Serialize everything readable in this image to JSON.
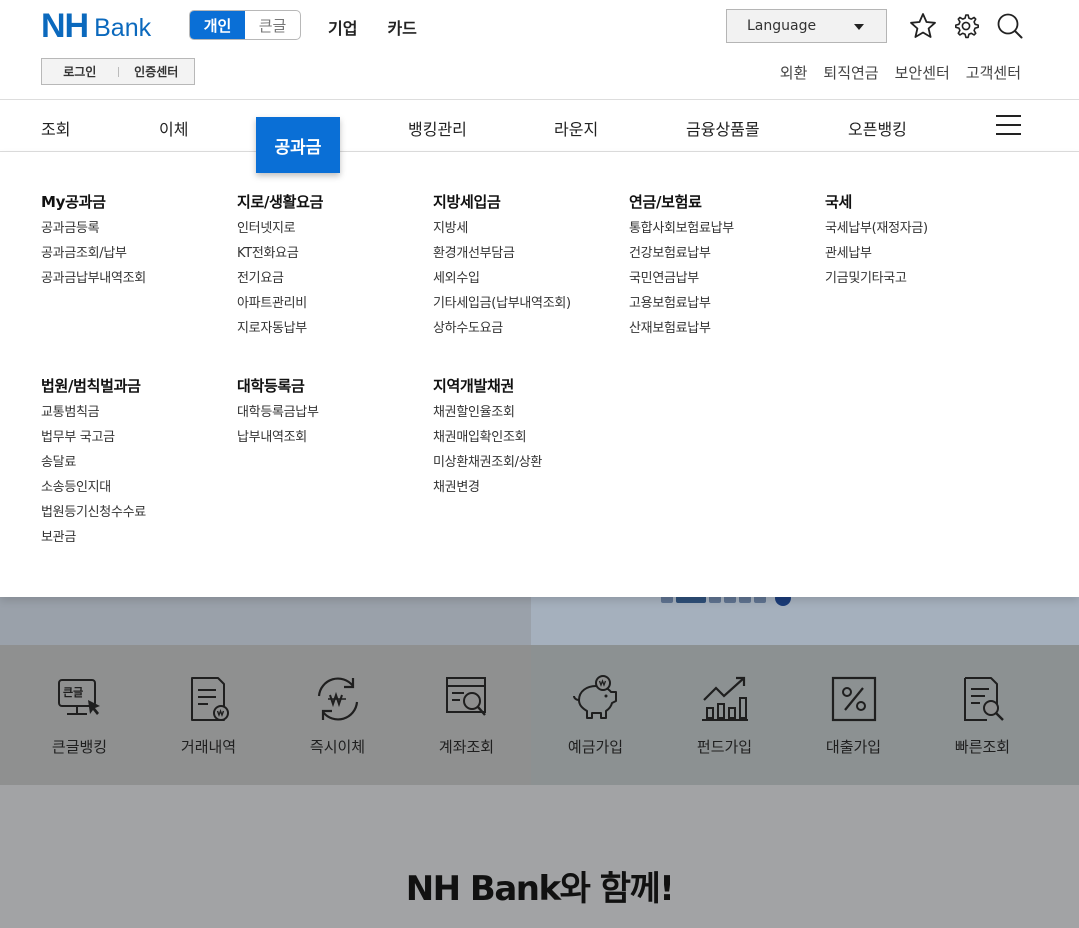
{
  "header": {
    "logo_nh": "NH",
    "logo_bank": "Bank",
    "segment": [
      "개인",
      "큰글"
    ],
    "top_nav": [
      "기업",
      "카드"
    ],
    "language": "Language",
    "login": "로그인",
    "cert": "인증센터",
    "util_links": [
      "외환",
      "퇴직연금",
      "보안센터",
      "고객센터"
    ]
  },
  "gnb": {
    "items": [
      "조회",
      "이체",
      "공과금",
      "뱅킹관리",
      "라운지",
      "금융상품몰",
      "오픈뱅킹"
    ],
    "active": "공과금"
  },
  "mega_menu": [
    {
      "title": "My공과금",
      "items": [
        "공과금등록",
        "공과금조회/납부",
        "공과금납부내역조회"
      ]
    },
    {
      "title": "지로/생활요금",
      "items": [
        "인터넷지로",
        "KT전화요금",
        "전기요금",
        "아파트관리비",
        "지로자동납부"
      ]
    },
    {
      "title": "지방세입금",
      "items": [
        "지방세",
        "환경개선부담금",
        "세외수입",
        "기타세입금(납부내역조회)",
        "상하수도요금"
      ]
    },
    {
      "title": "연금/보험료",
      "items": [
        "통합사회보험료납부",
        "건강보험료납부",
        "국민연금납부",
        "고용보험료납부",
        "산재보험료납부"
      ]
    },
    {
      "title": "국세",
      "items": [
        "국세납부(재정자금)",
        "관세납부",
        "기금및기타국고"
      ]
    },
    {
      "title": "법원/범칙벌과금",
      "items": [
        "교통범칙금",
        "법무부 국고금",
        "송달료",
        "소송등인지대",
        "법원등기신청수수료",
        "보관금"
      ]
    },
    {
      "title": "대학등록금",
      "items": [
        "대학등록금납부",
        "납부내역조회"
      ]
    },
    {
      "title": "지역개발채권",
      "items": [
        "채권할인율조회",
        "채권매입확인조회",
        "미상환채권조회/상환",
        "채권변경"
      ]
    }
  ],
  "quick_menu": [
    {
      "label": "큰글뱅킹",
      "icon": "large-text-banking-icon",
      "badge": "큰글"
    },
    {
      "label": "거래내역",
      "icon": "transaction-history-icon"
    },
    {
      "label": "즉시이체",
      "icon": "instant-transfer-icon"
    },
    {
      "label": "계좌조회",
      "icon": "account-inquiry-icon"
    },
    {
      "label": "예금가입",
      "icon": "piggy-bank-icon"
    },
    {
      "label": "펀드가입",
      "icon": "fund-chart-icon"
    },
    {
      "label": "대출가입",
      "icon": "loan-percent-icon"
    },
    {
      "label": "빠른조회",
      "icon": "quick-search-icon"
    }
  ],
  "slogan": "NH Bank와 함께!",
  "colors": {
    "brand": "#0b69bd",
    "active": "#0a6fd6"
  }
}
